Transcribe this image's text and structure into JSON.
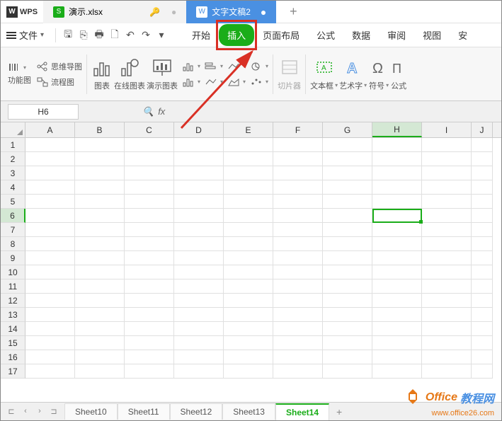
{
  "titlebar": {
    "logo": "WPS",
    "tab1": {
      "icon": "S",
      "label": "演示.xlsx",
      "key": "🔑"
    },
    "tab2": {
      "icon": "W",
      "label": "文字文稿2"
    }
  },
  "menubar": {
    "file": "文件",
    "tabs": [
      "开始",
      "插入",
      "页面布局",
      "公式",
      "数据",
      "审阅",
      "视图",
      "安"
    ]
  },
  "ribbon": {
    "mindmap": "思维导图",
    "flowchart": "流程图",
    "funcchart": "功能图",
    "chart": "图表",
    "onlinechart": "在线图表",
    "prechart": "演示图表",
    "slicer": "切片器",
    "textbox": "文本框",
    "wordart": "艺术字",
    "symbol": "符号",
    "formula": "公式"
  },
  "formula_bar": {
    "name_box": "H6",
    "fx": "fx"
  },
  "grid": {
    "columns": [
      "A",
      "B",
      "C",
      "D",
      "E",
      "F",
      "G",
      "H",
      "I",
      "J"
    ],
    "rows": [
      "1",
      "2",
      "3",
      "4",
      "5",
      "6",
      "7",
      "8",
      "9",
      "10",
      "11",
      "12",
      "13",
      "14",
      "15",
      "16",
      "17"
    ],
    "selected_col": "H",
    "selected_row": "6"
  },
  "sheets": {
    "items": [
      "Sheet10",
      "Sheet11",
      "Sheet12",
      "Sheet13",
      "Sheet14"
    ],
    "active": "Sheet14"
  },
  "watermark": {
    "brand1": "Office",
    "brand2": "教程网",
    "url": "www.office26.com"
  }
}
